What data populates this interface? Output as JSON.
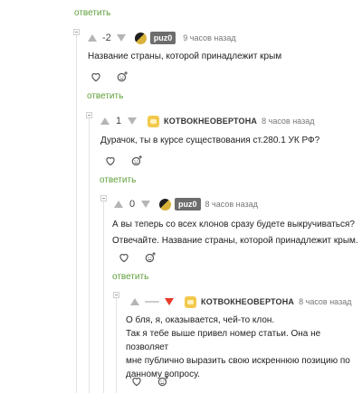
{
  "top": {
    "reply_label": "ответить"
  },
  "comments": [
    {
      "score": "-2",
      "author": "puz0",
      "time": "9 часов назад",
      "text": [
        "Название страны, которой принадлежит крым"
      ],
      "reply_label": "ответить"
    },
    {
      "score": "1",
      "author": "КОТВОКНЕОВЕРТОНА",
      "time": "8 часов назад",
      "text": [
        "Дурачок, ты в курсе существования ст.280.1 УК РФ?"
      ],
      "reply_label": "ответить"
    },
    {
      "score": "0",
      "author": "puz0",
      "time": "8 часов назад",
      "text": [
        "А вы теперь со всех клонов сразу будете выкручиваться?",
        "Отвечайте. Название страны, которой принадлежит крым."
      ],
      "reply_label": "ответить"
    },
    {
      "score": "",
      "author": "КОТВОКНЕОВЕРТОНА",
      "time": "8 часов назад",
      "text": [
        "О бля, я, оказывается, чей-то клон.",
        "Так я тебе выше привел номер статьи. Она не позволяет",
        "мне публично выразить свою искреннюю позицию по",
        "данному вопросу."
      ],
      "reply_label": ""
    }
  ],
  "colors": {
    "reply": "#5e9f39",
    "downvote_active": "#e8392b"
  }
}
